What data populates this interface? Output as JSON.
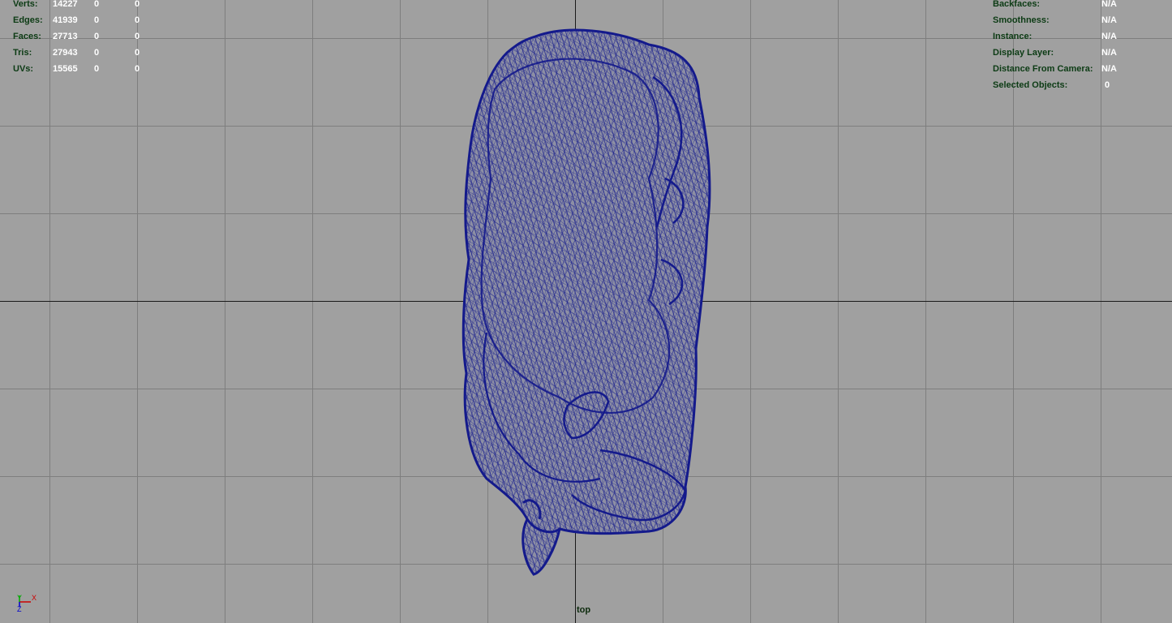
{
  "hud_left": [
    {
      "label": "Verts:",
      "v1": "14227",
      "v2": "0",
      "v3": "0"
    },
    {
      "label": "Edges:",
      "v1": "41939",
      "v2": "0",
      "v3": "0"
    },
    {
      "label": "Faces:",
      "v1": "27713",
      "v2": "0",
      "v3": "0"
    },
    {
      "label": "Tris:",
      "v1": "27943",
      "v2": "0",
      "v3": "0"
    },
    {
      "label": "UVs:",
      "v1": "15565",
      "v2": "0",
      "v3": "0"
    }
  ],
  "hud_right": [
    {
      "label": "Backfaces:",
      "value": "N/A"
    },
    {
      "label": "Smoothness:",
      "value": "N/A"
    },
    {
      "label": "Instance:",
      "value": "N/A"
    },
    {
      "label": "Display Layer:",
      "value": "N/A"
    },
    {
      "label": "Distance From Camera:",
      "value": "N/A"
    },
    {
      "label": "Selected Objects:",
      "value": "0"
    }
  ],
  "camera_label": "top",
  "axis_labels": {
    "y": "Y",
    "x": "X",
    "z": "Z"
  },
  "colors": {
    "background": "#a0a0a0",
    "grid": "#7e7e7e",
    "grid_axis": "#1a1a1a",
    "wireframe": "#141a8c",
    "mesh_fill": "#8d8fa4",
    "hud_label": "#0c3b14",
    "hud_value": "#ffffff"
  }
}
